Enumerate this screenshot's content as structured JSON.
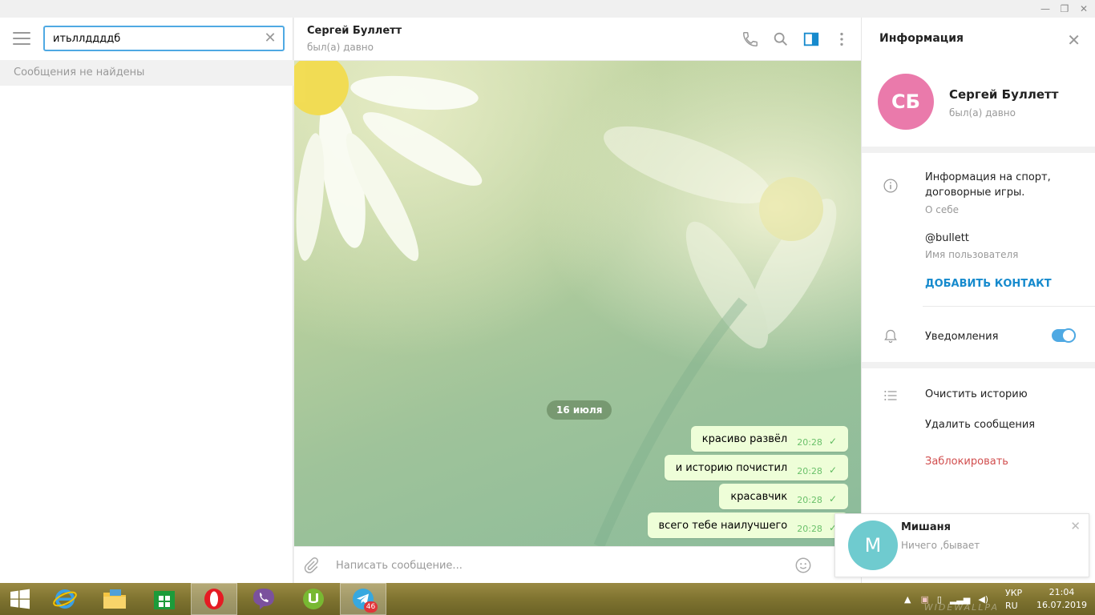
{
  "window": {
    "minimize": "—",
    "maximize": "❐",
    "close": "✕"
  },
  "search": {
    "value": "итьллддддб",
    "clear": "✕",
    "no_results": "Сообщения не найдены"
  },
  "chat": {
    "name": "Сергей Буллетт",
    "status": "был(а) давно",
    "date": "16 июля",
    "messages": [
      {
        "text": "красиво развёл",
        "time": "20:28"
      },
      {
        "text": "и историю почистил",
        "time": "20:28"
      },
      {
        "text": "красавчик",
        "time": "20:28"
      },
      {
        "text": "всего тебе наилучшего",
        "time": "20:28"
      }
    ],
    "composer_placeholder": "Написать сообщение..."
  },
  "info": {
    "title": "Информация",
    "close": "✕",
    "avatar_initials": "СБ",
    "avatar_color": "#ea7aab",
    "name": "Сергей Буллетт",
    "status": "был(а) давно",
    "bio": "Информация на спорт, договорные игры.",
    "bio_label": "О себе",
    "username": "@bullett",
    "username_label": "Имя пользователя",
    "add_contact": "ДОБАВИТЬ КОНТАКТ",
    "notifications": "Уведомления",
    "notifications_on": true,
    "clear_history": "Очистить историю",
    "delete_messages": "Удалить сообщения",
    "block": "Заблокировать"
  },
  "notification": {
    "avatar_initial": "М",
    "avatar_color": "#6fcbcf",
    "name": "Мишаня",
    "text": "Ничего ,бывает",
    "close": "✕"
  },
  "taskbar": {
    "telegram_badge": "46",
    "lang_top": "УКР",
    "lang_bottom": "RU",
    "time": "21:04",
    "date": "16.07.2019",
    "watermark": "WIDEWALLPA"
  },
  "colors": {
    "accent": "#4fa9e3",
    "link": "#168acd",
    "danger": "#d14e4e",
    "bubble": "#eefed8",
    "check": "#5fba5f"
  }
}
